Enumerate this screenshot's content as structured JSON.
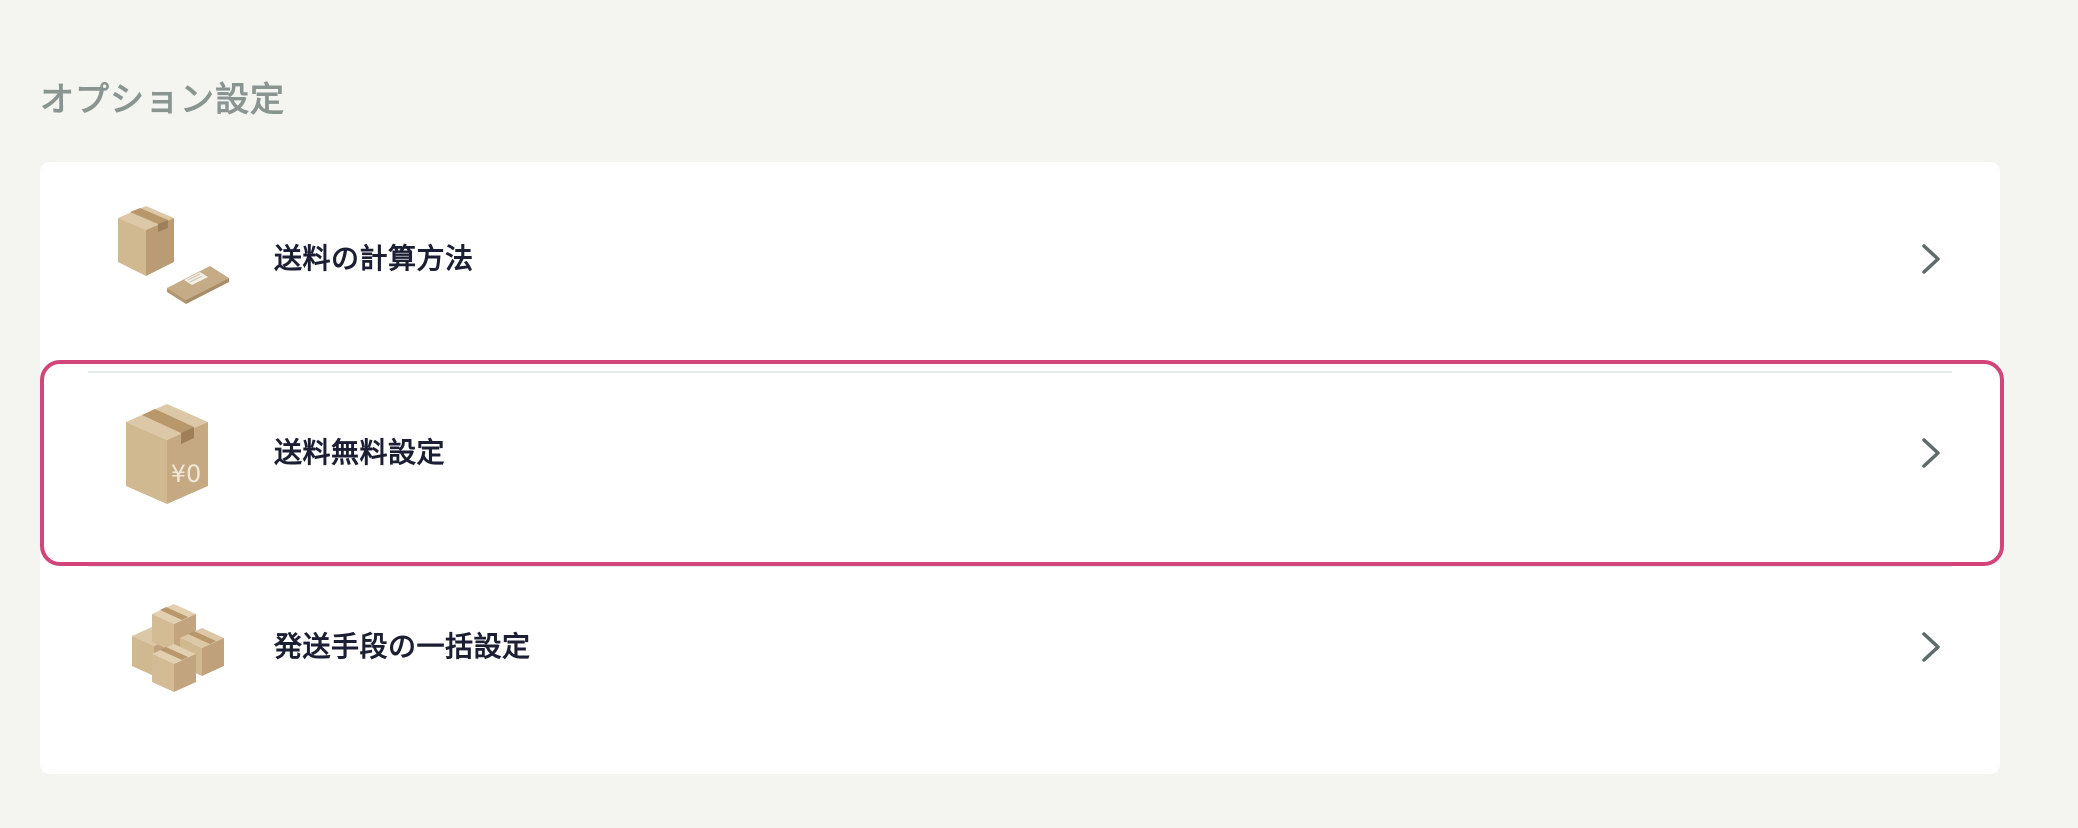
{
  "section": {
    "title": "オプション設定"
  },
  "options": [
    {
      "label": "送料の計算方法",
      "icon": "box-and-envelope-icon"
    },
    {
      "label": "送料無料設定",
      "icon": "box-yen-zero-icon",
      "icon_text": "¥0",
      "highlighted": true
    },
    {
      "label": "発送手段の一括設定",
      "icon": "stacked-boxes-icon"
    }
  ],
  "colors": {
    "background": "#f4f4f1",
    "card": "#ffffff",
    "title": "#8a9592",
    "label": "#1c1f33",
    "chevron": "#5e6b6b",
    "highlight": "#d2457b",
    "box": "#cdb596"
  }
}
